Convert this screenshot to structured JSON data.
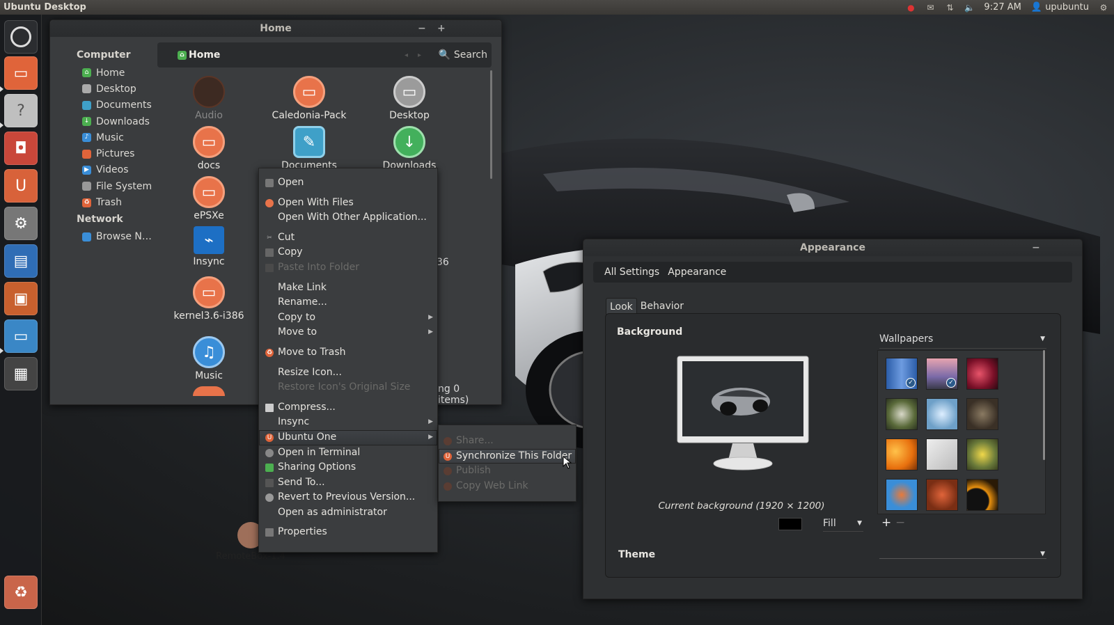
{
  "panel": {
    "title": "Ubuntu Desktop",
    "time": "9:27 AM",
    "user": "upubuntu",
    "indicators": [
      "mic-icon",
      "mail-icon",
      "network-icon",
      "volume-icon"
    ]
  },
  "launcher": {
    "items": [
      "dash-home",
      "files",
      "help",
      "software-center",
      "ubuntu-one",
      "system-settings",
      "libreoffice-writer",
      "libreoffice-impress",
      "remote-desktop",
      "workspace-switcher",
      "trash"
    ]
  },
  "files": {
    "title": "Home",
    "sidebar": {
      "computer_heading": "Computer",
      "computer_items": [
        "Home",
        "Desktop",
        "Documents",
        "Downloads",
        "Music",
        "Pictures",
        "Videos",
        "File System",
        "Trash"
      ],
      "network_heading": "Network",
      "network_items": [
        "Browse N…"
      ]
    },
    "pathbar": {
      "crumb": "Home",
      "search": "Search"
    },
    "icons": [
      "Audio",
      "Caledonia-Pack",
      "Desktop",
      "docs",
      "Documents",
      "Downloads",
      "ePSXe",
      "Insync",
      "kernel3.6-i386",
      "Music"
    ],
    "status_fragment": "ng 0 items)",
    "partial_label": "36"
  },
  "context_menu": {
    "items": [
      {
        "label": "Open"
      },
      {
        "label": "Open With Files"
      },
      {
        "label": "Open With Other Application..."
      },
      {
        "label": "Cut"
      },
      {
        "label": "Copy"
      },
      {
        "label": "Paste Into Folder"
      },
      {
        "label": "Make Link"
      },
      {
        "label": "Rename..."
      },
      {
        "label": "Copy to"
      },
      {
        "label": "Move to"
      },
      {
        "label": "Move to Trash"
      },
      {
        "label": "Resize Icon..."
      },
      {
        "label": "Restore Icon's Original Size"
      },
      {
        "label": "Compress..."
      },
      {
        "label": "Insync"
      },
      {
        "label": "Ubuntu One"
      },
      {
        "label": "Open in Terminal"
      },
      {
        "label": "Sharing Options"
      },
      {
        "label": "Send To..."
      },
      {
        "label": "Revert to Previous Version..."
      },
      {
        "label": "Open as administrator"
      },
      {
        "label": "Properties"
      }
    ],
    "submenu": [
      "Share...",
      "Synchronize This Folder",
      "Publish",
      "Copy Web Link"
    ]
  },
  "appearance": {
    "title": "Appearance",
    "toolbar": {
      "all_settings": "All Settings",
      "current": "Appearance"
    },
    "tabs": [
      "Look",
      "Behavior"
    ],
    "background_label": "Background",
    "current_background": "Current background (1920 × 1200)",
    "wallpapers_label": "Wallpapers",
    "fill_label": "Fill",
    "plus": "+",
    "minus": "−",
    "theme_label": "Theme"
  },
  "desktop_icon": {
    "label": "RemoteBox-1.4"
  },
  "colors": {
    "ubuntu_orange": "#e95420",
    "accent_green": "#4caf50",
    "accent_blue": "#3a8ed8"
  }
}
